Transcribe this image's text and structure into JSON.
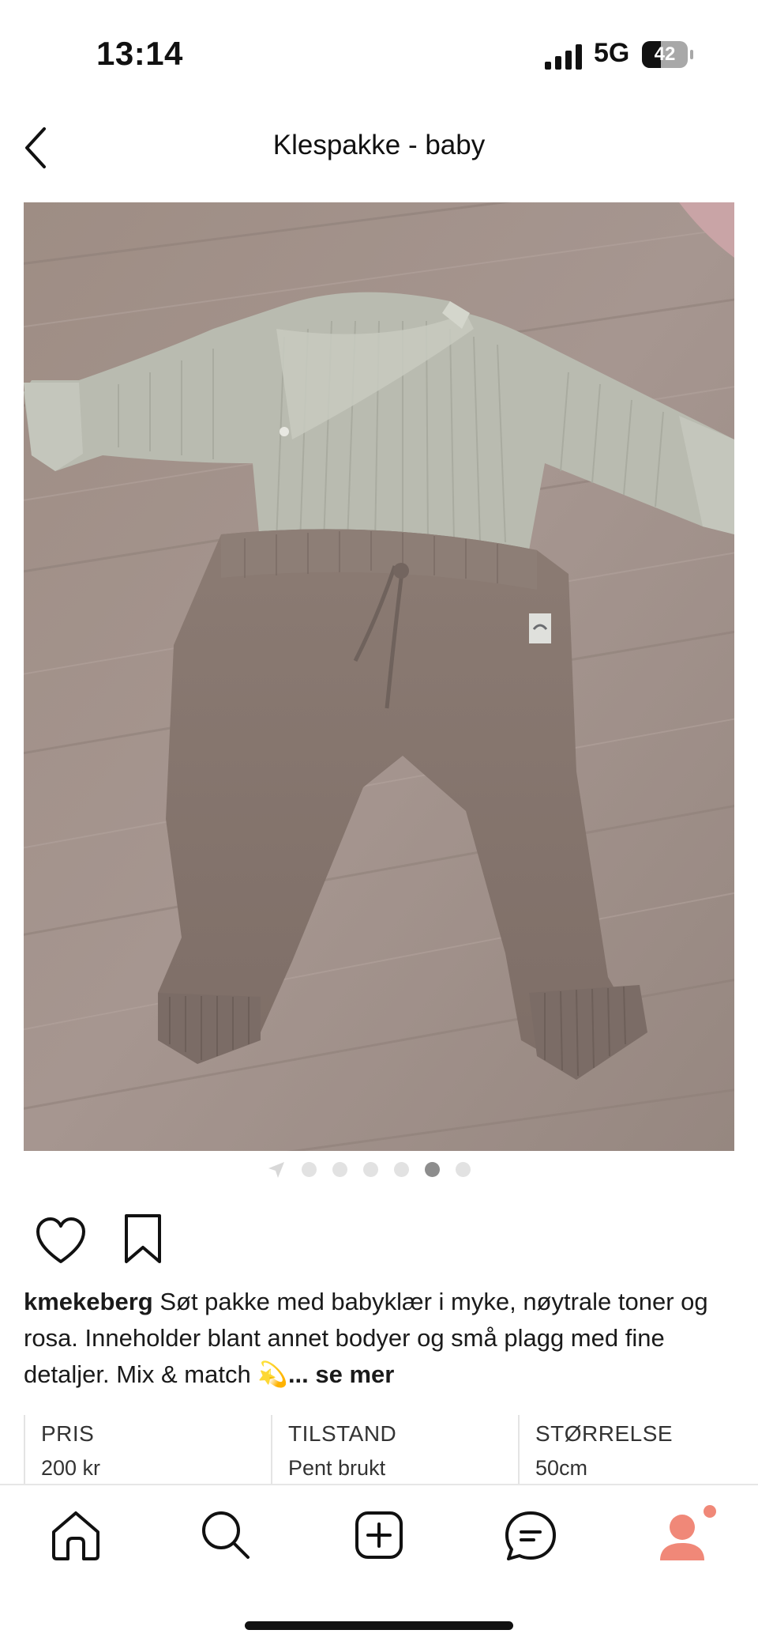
{
  "status_bar": {
    "time": "13:14",
    "network": "5G",
    "battery": "42",
    "battery_level": 0.42
  },
  "header": {
    "title": "Klespakke - baby",
    "back_icon": "chevron-left-icon"
  },
  "photo": {
    "image_count": 6,
    "active_index": 4
  },
  "actions": {
    "like_icon": "heart-icon",
    "save_icon": "bookmark-icon"
  },
  "caption": {
    "username": "kmekeberg",
    "text": " Søt pakke med babyklær i myke, nøytrale toner og rosa. Inneholder blant annet bodyer og små plagg med fine detaljer. Mix & match 💫",
    "more": "... se mer"
  },
  "details": [
    {
      "label": "PRIS",
      "value": "200 kr"
    },
    {
      "label": "TILSTAND",
      "value": "Pent brukt"
    },
    {
      "label": "STØRRELSE",
      "value": "50cm"
    }
  ],
  "bottom_nav": {
    "items": [
      "home-icon",
      "search-icon",
      "add-icon",
      "messages-icon",
      "profile-icon"
    ],
    "notification_color": "#f08878",
    "profile_color": "#f08878"
  }
}
